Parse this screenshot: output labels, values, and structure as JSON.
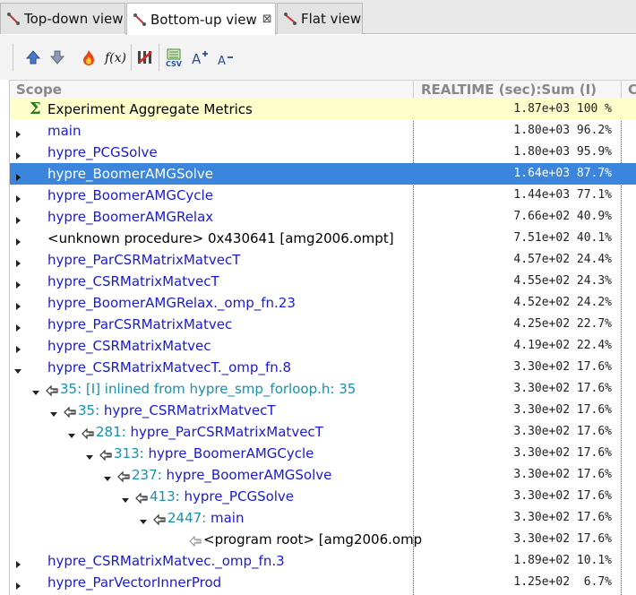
{
  "tabs": [
    {
      "label": "Top-down view",
      "active": false
    },
    {
      "label": "Bottom-up view",
      "active": true
    },
    {
      "label": "Flat view",
      "active": false
    }
  ],
  "toolbar": {
    "buttons": [
      "up-arrow-icon",
      "down-arrow-icon",
      "hot-path-flame-icon",
      "derived-metric-fx-icon",
      "column-select-icon",
      "export-csv-icon",
      "font-increase-icon",
      "font-decrease-icon"
    ]
  },
  "columns": {
    "scope": "Scope",
    "metric": "REALTIME (sec):Sum (I)",
    "third": "C"
  },
  "rows": [
    {
      "label": "Experiment Aggregate Metrics",
      "value": "1.87e+03 100 %",
      "style": "agg"
    },
    {
      "label": "main",
      "value": "1.80e+03 96.2%"
    },
    {
      "label": "hypre_PCGSolve",
      "value": "1.80e+03 95.9%"
    },
    {
      "label": "hypre_BoomerAMGSolve",
      "value": "1.64e+03 87.7%",
      "style": "selected"
    },
    {
      "label": "hypre_BoomerAMGCycle",
      "value": "1.44e+03 77.1%"
    },
    {
      "label": "hypre_BoomerAMGRelax",
      "value": "7.66e+02 40.9%"
    },
    {
      "label": "<unknown procedure> 0x430641 [amg2006.ompt]",
      "value": "7.51e+02 40.1%"
    },
    {
      "label": "hypre_ParCSRMatrixMatvecT",
      "value": "4.57e+02 24.4%"
    },
    {
      "label": "hypre_CSRMatrixMatvecT",
      "value": "4.55e+02 24.3%"
    },
    {
      "label": "hypre_BoomerAMGRelax._omp_fn.23",
      "value": "4.52e+02 24.2%"
    },
    {
      "label": "hypre_ParCSRMatrixMatvec",
      "value": "4.25e+02 22.7%"
    },
    {
      "label": "hypre_CSRMatrixMatvec",
      "value": "4.19e+02 22.4%"
    },
    {
      "label": "hypre_CSRMatrixMatvecT._omp_fn.8",
      "value": "3.30e+02 17.6%"
    },
    {
      "label": "35: [I] inlined from hypre_smp_forloop.h: 35",
      "value": "3.30e+02 17.6%"
    },
    {
      "label": "35: hypre_CSRMatrixMatvecT",
      "value": "3.30e+02 17.6%"
    },
    {
      "label": "281: hypre_ParCSRMatrixMatvecT",
      "value": "3.30e+02 17.6%"
    },
    {
      "label": "313: hypre_BoomerAMGCycle",
      "value": "3.30e+02 17.6%"
    },
    {
      "label": "237: hypre_BoomerAMGSolve",
      "value": "3.30e+02 17.6%"
    },
    {
      "label": "413: hypre_PCGSolve",
      "value": "3.30e+02 17.6%"
    },
    {
      "label": "2447: main",
      "value": "3.30e+02 17.6%"
    },
    {
      "label": "<program root> [amg2006.omp",
      "value": "3.30e+02 17.6%"
    },
    {
      "label": "hypre_CSRMatrixMatvec._omp_fn.3",
      "value": "1.89e+02 10.1%"
    },
    {
      "label": "hypre_ParVectorInnerProd",
      "value": "1.25e+02  6.7%"
    }
  ]
}
